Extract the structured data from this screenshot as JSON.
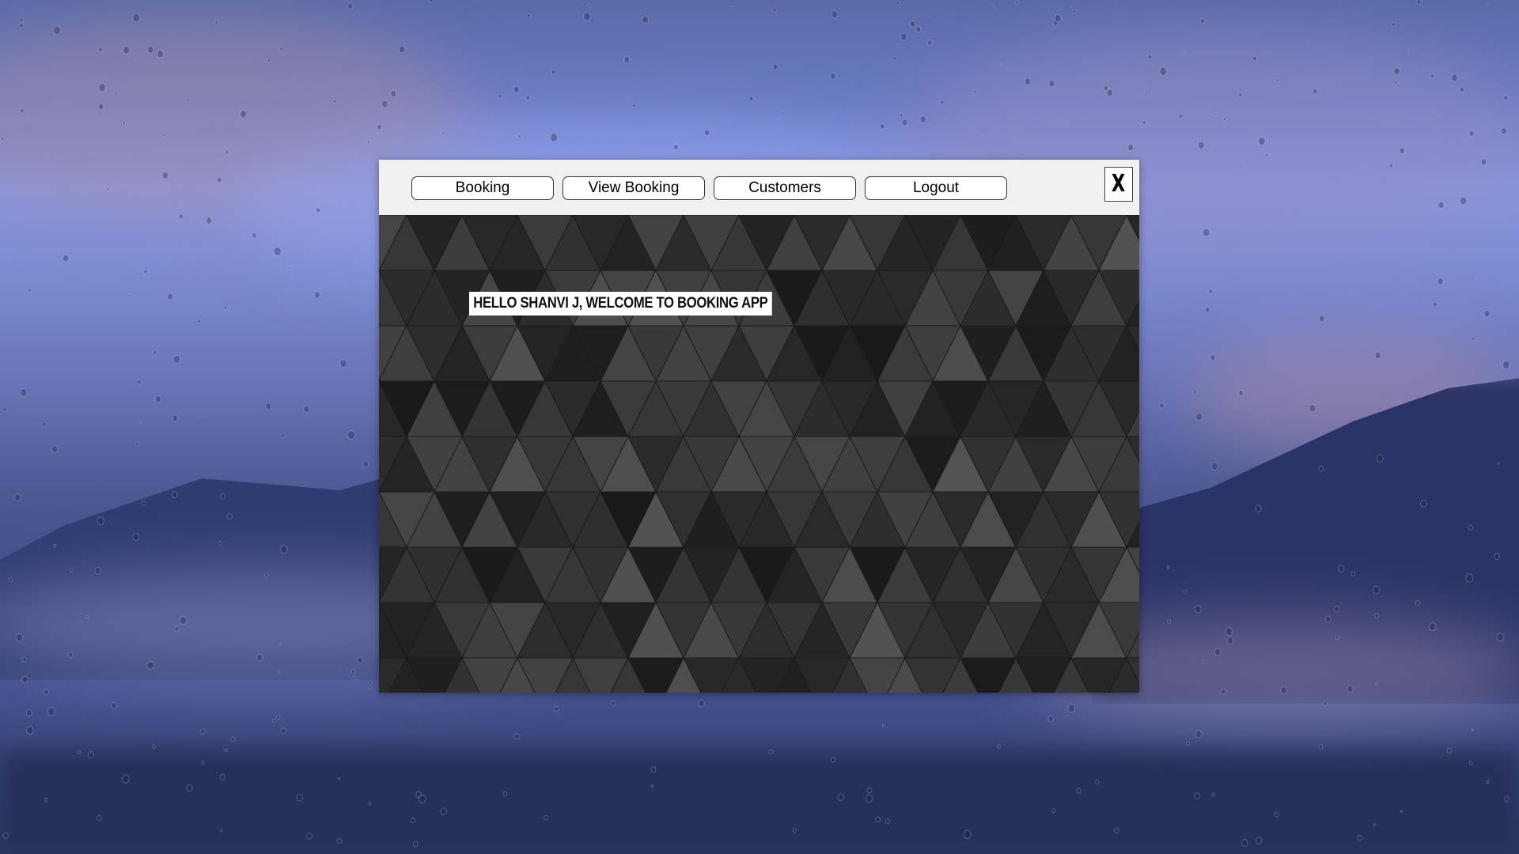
{
  "window": {
    "menu": {
      "booking_label": "Booking",
      "view_booking_label": "View Booking",
      "customers_label": "Customers",
      "logout_label": "Logout"
    },
    "close_label": "X"
  },
  "content": {
    "welcome_text": "HELLO SHANVI J, WELCOME TO BOOKING APP"
  },
  "colors": {
    "menubar_bg": "#f0f0f0",
    "content_bg": "#262626",
    "button_bg": "#ffffff"
  },
  "icons": {
    "close": "close-icon"
  }
}
